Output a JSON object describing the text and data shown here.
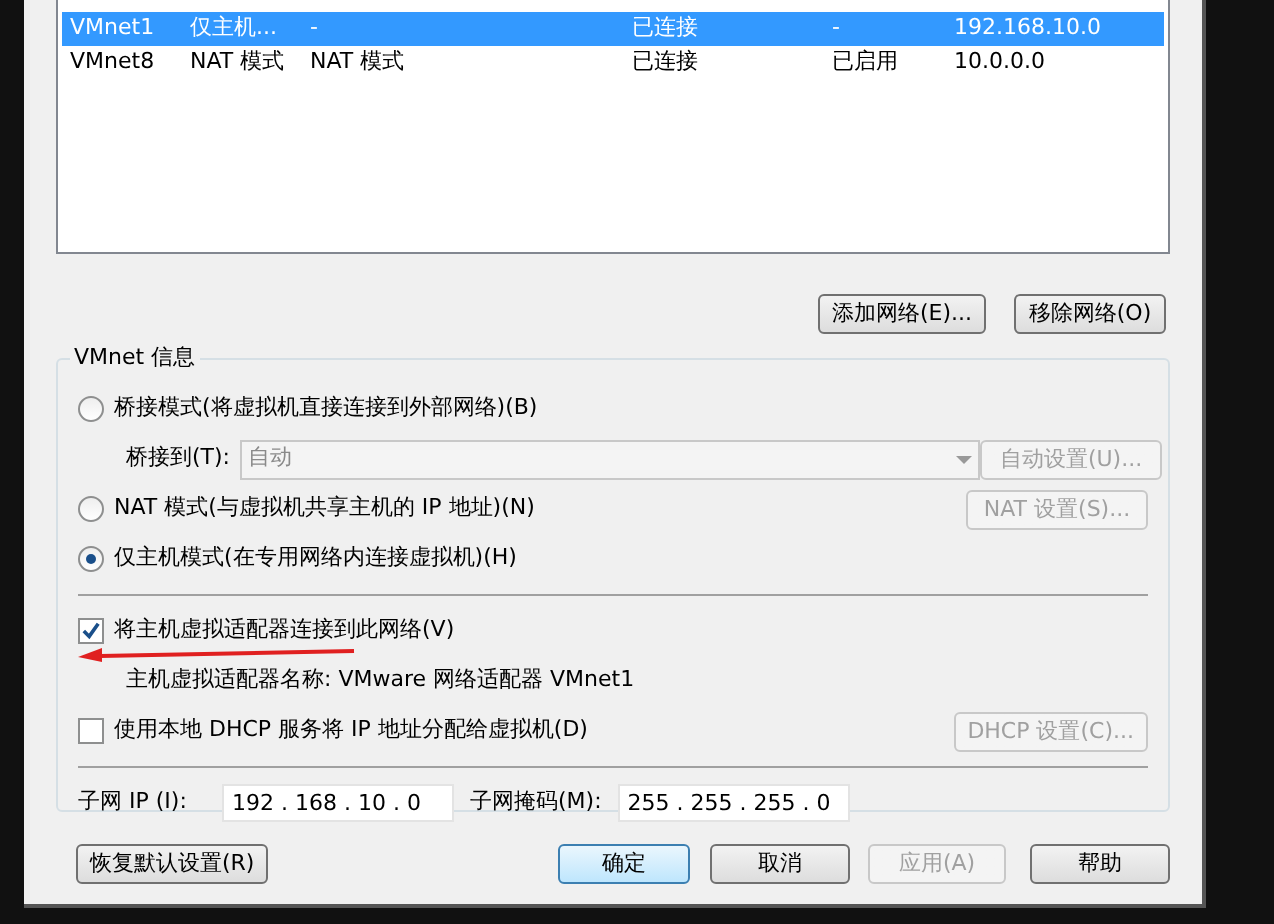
{
  "network_rows": [
    {
      "cells": [
        "VMnet1",
        "仅主机...",
        "-",
        "已连接",
        "-",
        "192.168.10.0"
      ],
      "selected": true
    },
    {
      "cells": [
        "VMnet8",
        "NAT 模式",
        "NAT 模式",
        "已连接",
        "已启用",
        "10.0.0.0"
      ],
      "selected": false
    }
  ],
  "list_buttons": [
    {
      "label": "添加网络(E)..."
    },
    {
      "label": "移除网络(O)"
    }
  ],
  "vmnet_info": {
    "title": "VMnet 信息",
    "rows": [
      {
        "kind": "radio",
        "label": "桥接模式(将虚拟机直接连接到外部网络)(B)",
        "selected": false
      },
      {
        "kind": "combo",
        "label": "桥接到(T):",
        "value": "自动",
        "disabled": true,
        "button": {
          "label": "自动设置(U)...",
          "disabled": true
        }
      },
      {
        "kind": "radio",
        "label": "NAT 模式(与虚拟机共享主机的 IP 地址)(N)",
        "selected": false,
        "button": {
          "label": "NAT 设置(S)...",
          "disabled": true
        }
      },
      {
        "kind": "radio",
        "label": "仅主机模式(在专用网络内连接虚拟机)(H)",
        "selected": true
      },
      {
        "kind": "divider"
      },
      {
        "kind": "checkbox",
        "label": "将主机虚拟适配器连接到此网络(V)",
        "checked": true
      },
      {
        "kind": "note",
        "label": "主机虚拟适配器名称: VMware 网络适配器 VMnet1"
      },
      {
        "kind": "checkbox",
        "label": "使用本地 DHCP 服务将 IP 地址分配给虚拟机(D)",
        "checked": false,
        "button": {
          "label": "DHCP 设置(C)...",
          "disabled": true
        }
      },
      {
        "kind": "divider"
      }
    ],
    "fields": [
      {
        "label": "子网 IP (I):",
        "value": "192 . 168 . 10 . 0"
      },
      {
        "label": "子网掩码(M):",
        "value": "255 . 255 . 255 . 0"
      }
    ]
  },
  "footer_buttons": [
    {
      "label": "恢复默认设置(R)",
      "default": false,
      "disabled": false
    },
    {
      "label": "确定",
      "default": true,
      "disabled": false
    },
    {
      "label": "取消",
      "default": false,
      "disabled": false
    },
    {
      "label": "应用(A)",
      "default": false,
      "disabled": true
    },
    {
      "label": "帮助",
      "default": false,
      "disabled": false
    }
  ]
}
